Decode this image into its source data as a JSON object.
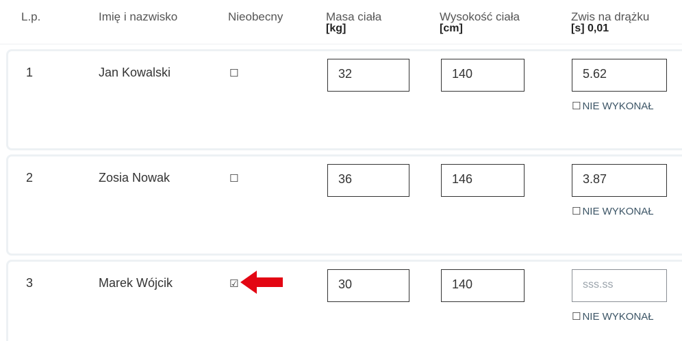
{
  "header": {
    "lp": "L.p.",
    "name": "Imię i nazwisko",
    "absent": "Nieobecny",
    "mass": "Masa ciała",
    "mass_unit": "[kg]",
    "height": "Wysokość ciała",
    "height_unit": "[cm]",
    "hang": "Zwis na drążku",
    "hang_unit": "[s] 0,01"
  },
  "rows": [
    {
      "lp": "1",
      "name": "Jan Kowalski",
      "absent_glyph": "☐",
      "absent_checked": false,
      "mass": "32",
      "height": "140",
      "hang": "5.62",
      "not_done_box": "☐",
      "not_done_label": "NIE WYKONAŁ"
    },
    {
      "lp": "2",
      "name": "Zosia Nowak",
      "absent_glyph": "☐",
      "absent_checked": false,
      "mass": "36",
      "height": "146",
      "hang": "3.87",
      "not_done_box": "☐",
      "not_done_label": "NIE WYKONAŁ"
    },
    {
      "lp": "3",
      "name": "Marek Wójcik",
      "absent_glyph": "☑",
      "absent_checked": true,
      "mass": "30",
      "height": "140",
      "hang_placeholder": "sss.ss",
      "not_done_box": "☐",
      "not_done_label": "NIE WYKONAŁ"
    }
  ],
  "annotation": {
    "icon": "red-arrow-icon",
    "color": "#e30613"
  }
}
